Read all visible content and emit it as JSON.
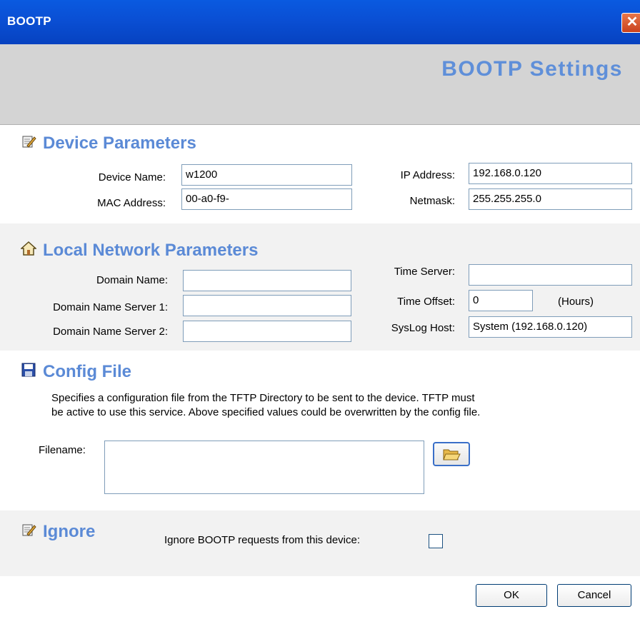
{
  "window": {
    "title": "BOOTP"
  },
  "header": {
    "title": "BOOTP Settings"
  },
  "device_parameters": {
    "heading": "Device Parameters",
    "device_name_label": "Device Name:",
    "device_name_value": "w1200",
    "mac_label": "MAC Address:",
    "mac_value": "00-a0-f9-",
    "ip_label": "IP Address:",
    "ip_value": "192.168.0.120",
    "netmask_label": "Netmask:",
    "netmask_value": "255.255.255.0"
  },
  "local_network": {
    "heading": "Local Network Parameters",
    "domain_name_label": "Domain Name:",
    "domain_name_value": "",
    "dns1_label": "Domain Name Server 1:",
    "dns1_value": "",
    "dns2_label": "Domain Name Server 2:",
    "dns2_value": "",
    "time_server_label": "Time Server:",
    "time_server_value": "",
    "time_offset_label": "Time Offset:",
    "time_offset_value": "0",
    "time_offset_unit": "(Hours)",
    "syslog_label": "SysLog Host:",
    "syslog_value": "System (192.168.0.120)"
  },
  "config_file": {
    "heading": "Config File",
    "description_line1": "Specifies a configuration file from the TFTP Directory to be sent to the device. TFTP must",
    "description_line2": "be active to use this service. Above specified values could be overwritten by the config file.",
    "filename_label": "Filename:",
    "filename_value": ""
  },
  "ignore": {
    "heading": "Ignore",
    "checkbox_label": "Ignore BOOTP requests from this device:",
    "checked": false
  },
  "buttons": {
    "ok": "OK",
    "cancel": "Cancel"
  },
  "icons": {
    "close": "close-icon",
    "device": "edit-pencil-icon",
    "network": "house-icon",
    "config": "floppy-disk-icon",
    "browse": "folder-open-icon",
    "ignore": "edit-pencil-icon"
  },
  "colors": {
    "titlebar": "#0a4fd4",
    "section_heading": "#5b8ad6",
    "header_band": "#d4d4d4",
    "band_gray": "#f2f2f2"
  }
}
